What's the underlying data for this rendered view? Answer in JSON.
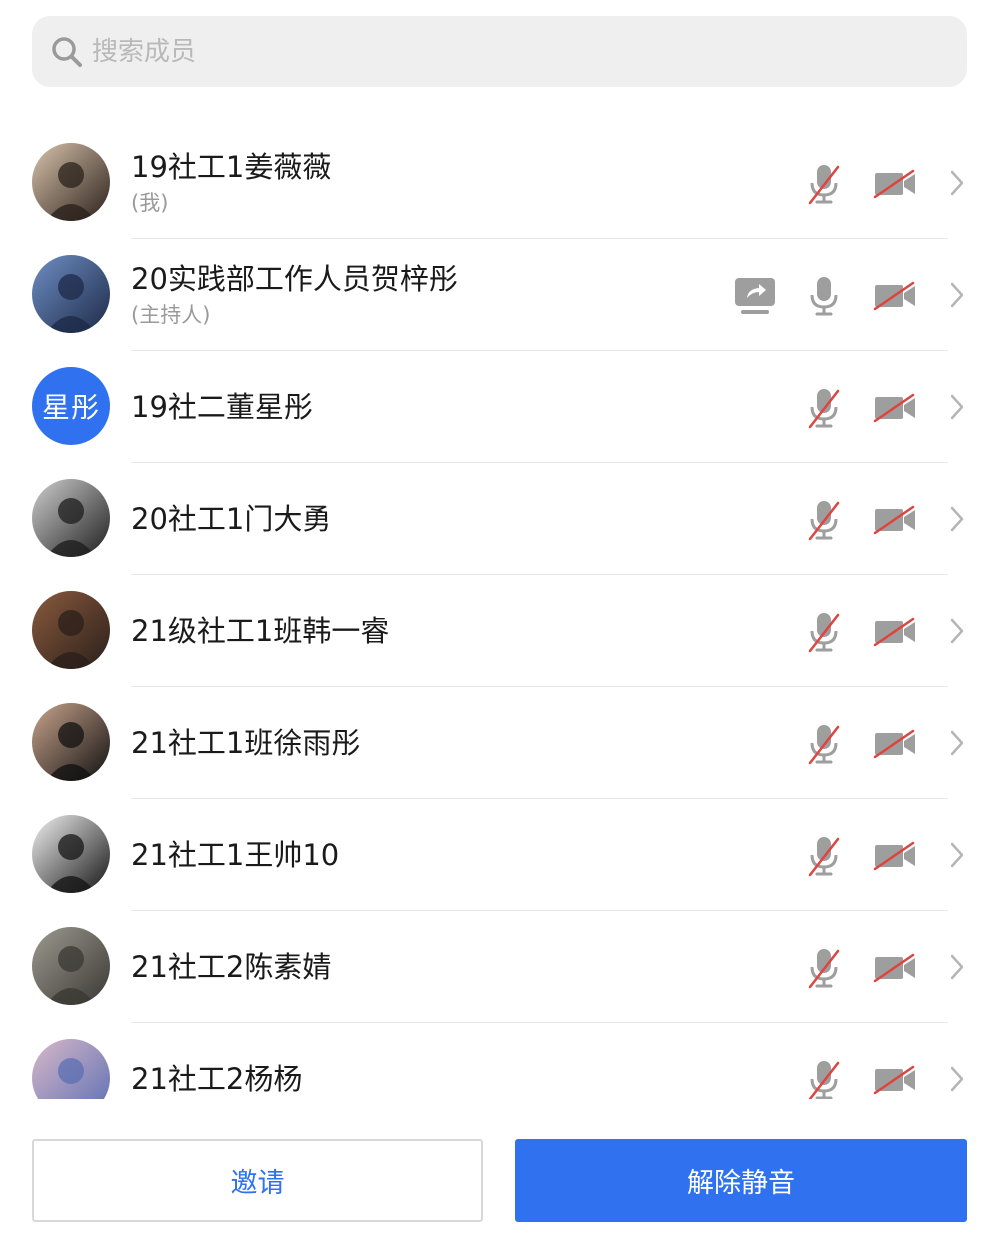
{
  "search": {
    "placeholder": "搜索成员"
  },
  "members": [
    {
      "name": "19社工1姜薇薇",
      "role": "(我)",
      "avatar_type": "photo",
      "avatar_colors": [
        "#d9c3ac",
        "#2b211c"
      ],
      "sharing": false,
      "mic_muted": true,
      "camera_off": true
    },
    {
      "name": "20实践部工作人员贺梓彤",
      "role": "(主持人)",
      "avatar_type": "photo",
      "avatar_colors": [
        "#6f8fc4",
        "#1d2a48"
      ],
      "sharing": true,
      "mic_muted": false,
      "camera_off": true
    },
    {
      "name": "19社二董星彤",
      "role": "",
      "avatar_type": "text",
      "avatar_text": "星彤",
      "sharing": false,
      "mic_muted": true,
      "camera_off": true
    },
    {
      "name": "20社工1门大勇",
      "role": "",
      "avatar_type": "photo",
      "avatar_colors": [
        "#cfcfcf",
        "#1e1e1e"
      ],
      "sharing": false,
      "mic_muted": true,
      "camera_off": true
    },
    {
      "name": "21级社工1班韩一睿",
      "role": "",
      "avatar_type": "photo",
      "avatar_colors": [
        "#8a5a3e",
        "#2a1f1a"
      ],
      "sharing": false,
      "mic_muted": true,
      "camera_off": true
    },
    {
      "name": "21社工1班徐雨彤",
      "role": "",
      "avatar_type": "photo",
      "avatar_colors": [
        "#c9a48c",
        "#111111"
      ],
      "sharing": false,
      "mic_muted": true,
      "camera_off": true
    },
    {
      "name": "21社工1王帅10",
      "role": "",
      "avatar_type": "photo",
      "avatar_colors": [
        "#f2f2f2",
        "#151515"
      ],
      "sharing": false,
      "mic_muted": true,
      "camera_off": true
    },
    {
      "name": "21社工2陈素婧",
      "role": "",
      "avatar_type": "photo",
      "avatar_colors": [
        "#9c9a90",
        "#3a3833"
      ],
      "sharing": false,
      "mic_muted": true,
      "camera_off": true
    },
    {
      "name": "21社工2杨杨",
      "role": "",
      "avatar_type": "photo",
      "avatar_colors": [
        "#d8b8c8",
        "#5b6fb3"
      ],
      "sharing": false,
      "mic_muted": true,
      "camera_off": true
    }
  ],
  "footer": {
    "invite_label": "邀请",
    "unmute_label": "解除静音"
  },
  "colors": {
    "accent": "#2f71ee",
    "muted_slash": "#e0443e",
    "icon_gray": "#9e9e9e"
  },
  "icons": {
    "search": "search-icon",
    "mic": "microphone-icon",
    "camera": "camera-icon",
    "share": "screen-share-icon",
    "chevron": "chevron-right-icon"
  }
}
